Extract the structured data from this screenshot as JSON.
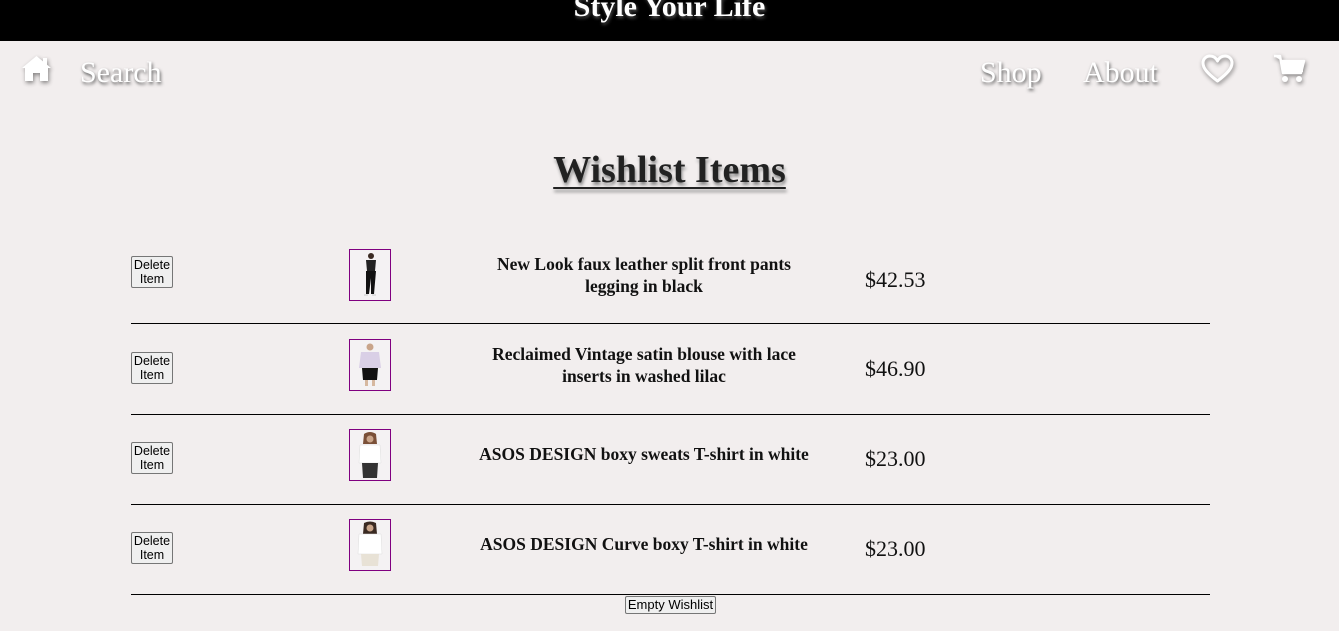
{
  "header": {
    "brand": "Style Your Life"
  },
  "nav": {
    "home_icon": "home-icon",
    "search_label": "Search",
    "shop_label": "Shop",
    "about_label": "About",
    "wishlist_icon": "heart-icon",
    "cart_icon": "cart-icon"
  },
  "page": {
    "title": "Wishlist Items"
  },
  "items": [
    {
      "delete_label": "Delete Item",
      "name": "New Look faux leather split front pants legging in black",
      "price": "$42.53"
    },
    {
      "delete_label": "Delete Item",
      "name": "Reclaimed Vintage satin blouse with lace inserts in washed lilac",
      "price": "$46.90"
    },
    {
      "delete_label": "Delete Item",
      "name": "ASOS DESIGN boxy sweats T-shirt in white",
      "price": "$23.00"
    },
    {
      "delete_label": "Delete Item",
      "name": "ASOS DESIGN Curve boxy T-shirt in white",
      "price": "$23.00"
    }
  ],
  "actions": {
    "empty_label": "Empty Wishlist"
  },
  "colors": {
    "background": "#f2eeee",
    "topbar": "#000000",
    "thumb_border": "#800080"
  }
}
